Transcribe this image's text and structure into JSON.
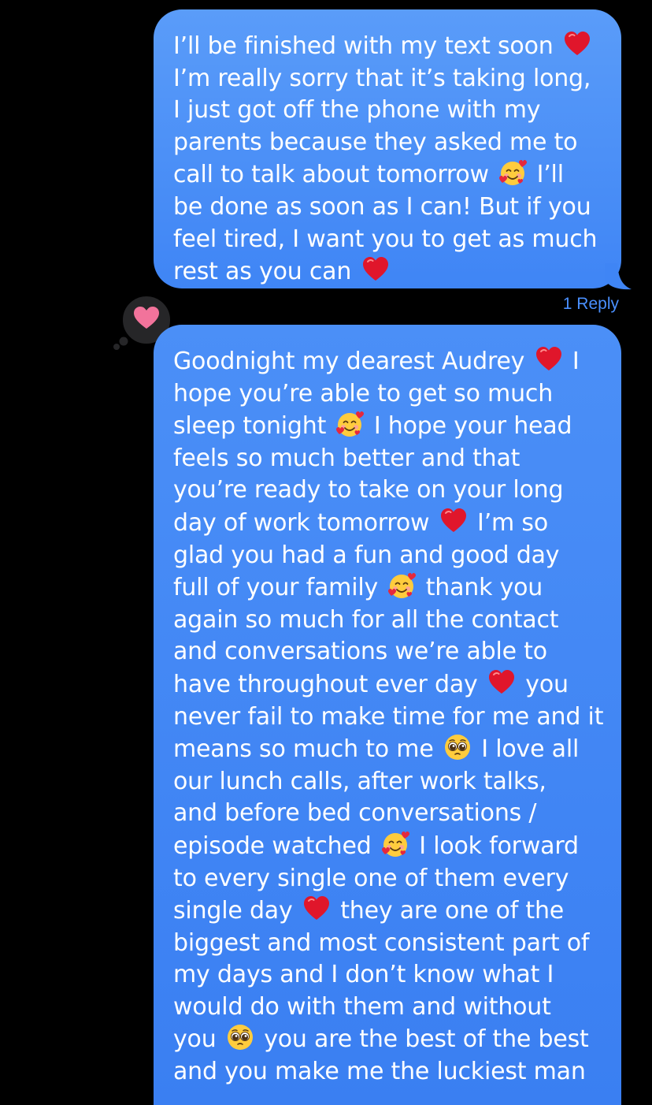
{
  "conversation": {
    "messages": [
      {
        "id": "msg-1",
        "lines": [
          [
            "I’ll be finished with my text soon ",
            "heart",
            ""
          ],
          [
            "I’m really sorry that it’s taking long,"
          ],
          [
            "I just got off the phone with my"
          ],
          [
            "parents because they asked me to"
          ],
          [
            "call to talk about tomorrow ",
            "smiling-face-with-hearts",
            " I’ll"
          ],
          [
            "be done as soon as I can! But if you"
          ],
          [
            "feel tired, I want you to get as much"
          ],
          [
            "rest as you can ",
            "heart",
            ""
          ]
        ]
      },
      {
        "id": "msg-2",
        "lines": [
          [
            "Goodnight my dearest Audrey ",
            "heart",
            " I"
          ],
          [
            "hope you’re able to get so much"
          ],
          [
            "sleep tonight ",
            "smiling-face-with-hearts",
            " I hope your head"
          ],
          [
            "feels so much better and that"
          ],
          [
            "you’re ready to take on your long"
          ],
          [
            "day of work tomorrow ",
            "heart",
            " I’m so"
          ],
          [
            "glad you had a fun and good day"
          ],
          [
            "full of your family ",
            "smiling-face-with-hearts",
            " thank you"
          ],
          [
            "again so much for all the contact"
          ],
          [
            "and conversations we’re able to"
          ],
          [
            "have throughout ever day ",
            "heart",
            " you"
          ],
          [
            "never fail to make time for me and it"
          ],
          [
            "means so much to me ",
            "pleading-face",
            " I love all"
          ],
          [
            "our lunch calls, after work talks,"
          ],
          [
            "and before bed conversations /"
          ],
          [
            "episode watched ",
            "smiling-face-with-hearts",
            " I look forward"
          ],
          [
            "to every single one of them every"
          ],
          [
            "single day ",
            "heart",
            " they are one of the"
          ],
          [
            "biggest and most consistent part of"
          ],
          [
            "my days and I don’t know what I"
          ],
          [
            "would do with them and without"
          ],
          [
            "you ",
            "pleading-face",
            " you are the best of the best"
          ],
          [
            "and you make me the luckiest man"
          ]
        ]
      }
    ],
    "reply_count_label": "1 Reply",
    "tapback": {
      "icon": "heart-icon",
      "color": "#f2739b"
    }
  },
  "colors": {
    "background": "#000000",
    "bubble": "#3f85f5",
    "link": "#4a90ff"
  }
}
